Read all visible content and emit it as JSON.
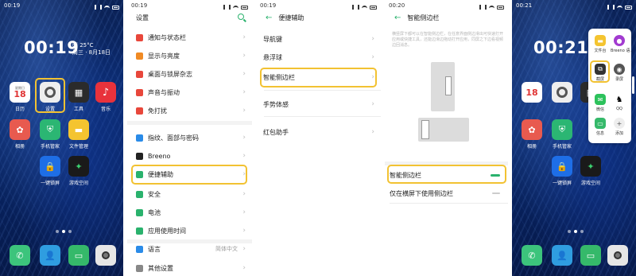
{
  "home1": {
    "time": "00:19",
    "clock": "00:19",
    "weather_line1": "晴 25°C",
    "weather_line2": "周三 · 8月18日",
    "apps_row1": [
      {
        "label": "日历",
        "day": "18",
        "weekday": "星期日"
      },
      {
        "label": "设置"
      },
      {
        "label": "工具"
      },
      {
        "label": "音乐",
        "glyph": "♪"
      }
    ],
    "apps_row2": [
      {
        "label": "相册"
      },
      {
        "label": "手机管家"
      },
      {
        "label": "文件管理"
      }
    ],
    "apps_row3": [
      {
        "label": "一键锁屏"
      },
      {
        "label": "游戏空间"
      }
    ]
  },
  "settings": {
    "time": "00:19",
    "title": "设置",
    "items": [
      {
        "label": "通知与状态栏",
        "color": "#e8473b"
      },
      {
        "label": "显示与亮度",
        "color": "#f08a24"
      },
      {
        "label": "桌面与锁屏杂志",
        "color": "#e8473b"
      },
      {
        "label": "声音与振动",
        "color": "#e8473b"
      },
      {
        "label": "免打扰",
        "color": "#e8473b"
      },
      {
        "label": "指纹、面部与密码",
        "color": "#2a8be8"
      },
      {
        "label": "Breeno",
        "color": "#222222"
      },
      {
        "label": "便捷辅助",
        "color": "#2ab26d"
      },
      {
        "label": "安全",
        "color": "#2ab26d"
      },
      {
        "label": "电池",
        "color": "#2ab26d"
      },
      {
        "label": "应用使用时间",
        "color": "#2ab26d"
      },
      {
        "label": "语言",
        "color": "#2a8be8",
        "value": "简体中文"
      },
      {
        "label": "其他设置",
        "color": "#888888"
      }
    ]
  },
  "assist": {
    "time": "00:19",
    "title": "便捷辅助",
    "items": [
      "导航键",
      "悬浮球",
      "智能侧边栏",
      "手势体感",
      "红包助手"
    ]
  },
  "sidebar": {
    "time": "00:20",
    "title": "智能侧边栏",
    "description": "横竖屏下都可以在智能侧边栏，在任意界面侧边滑出可快速打开应用或快捷工具，还能边滑边拖动打开应用，同屏之下边看视频边回消息。",
    "toggle1": "智能侧边栏",
    "toggle2": "仅在横屏下使用侧边栏"
  },
  "home2": {
    "time": "00:21",
    "clock": "00:21",
    "weather_line1": "晴 25°C",
    "weather_line2": "周三 · 8月18日",
    "popup": [
      {
        "label": "文件台"
      },
      {
        "label": "Breeno 语..."
      },
      {
        "label": "截屏"
      },
      {
        "label": "录屏"
      },
      {
        "label": "微信"
      },
      {
        "label": "QQ"
      },
      {
        "label": "信息"
      },
      {
        "label": "添加"
      }
    ],
    "apps_row2": [
      {
        "label": "相册"
      },
      {
        "label": "手机管家"
      }
    ],
    "apps_row3": [
      {
        "label": "一键锁屏"
      },
      {
        "label": "游戏空间"
      }
    ],
    "cal_day": "18"
  },
  "colors": {
    "accent": "#2ab26d",
    "highlight": "#f2c232"
  }
}
